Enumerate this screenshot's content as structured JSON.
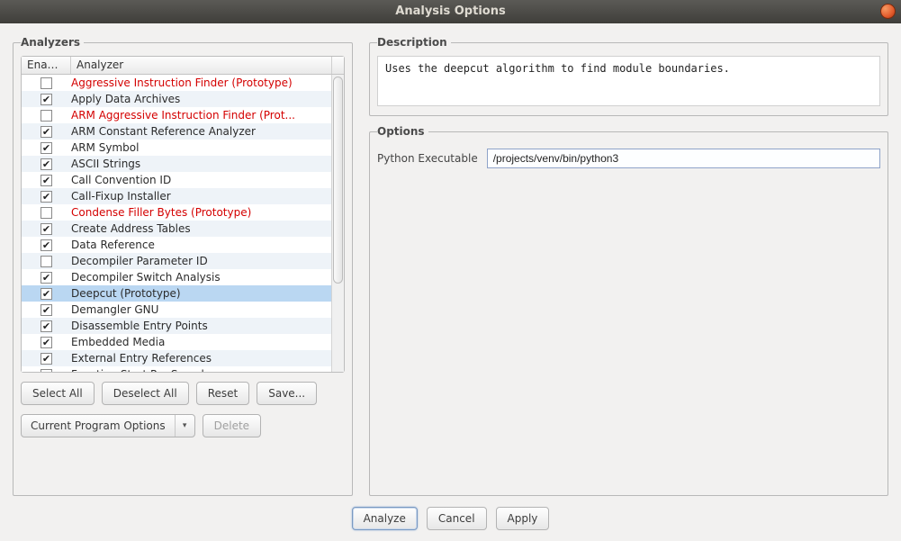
{
  "window": {
    "title": "Analysis Options"
  },
  "left": {
    "title": "Analyzers",
    "columns": {
      "enabled": "Enabl...",
      "analyzer": "Analyzer"
    },
    "rows": [
      {
        "checked": false,
        "name": "Aggressive Instruction Finder (Prototype)",
        "prototype": true
      },
      {
        "checked": true,
        "name": "Apply Data Archives"
      },
      {
        "checked": false,
        "name": "ARM Aggressive Instruction Finder (Prot...",
        "prototype": true
      },
      {
        "checked": true,
        "name": "ARM Constant Reference Analyzer"
      },
      {
        "checked": true,
        "name": "ARM Symbol"
      },
      {
        "checked": true,
        "name": "ASCII Strings"
      },
      {
        "checked": true,
        "name": "Call Convention ID"
      },
      {
        "checked": true,
        "name": "Call-Fixup Installer"
      },
      {
        "checked": false,
        "name": "Condense Filler Bytes (Prototype)",
        "prototype": true
      },
      {
        "checked": true,
        "name": "Create Address Tables"
      },
      {
        "checked": true,
        "name": "Data Reference"
      },
      {
        "checked": false,
        "name": "Decompiler Parameter ID"
      },
      {
        "checked": true,
        "name": "Decompiler Switch Analysis"
      },
      {
        "checked": true,
        "name": "Deepcut (Prototype)",
        "selected": true
      },
      {
        "checked": true,
        "name": "Demangler GNU"
      },
      {
        "checked": true,
        "name": "Disassemble Entry Points"
      },
      {
        "checked": true,
        "name": "Embedded Media"
      },
      {
        "checked": true,
        "name": "External Entry References"
      },
      {
        "checked": true,
        "name": "Function Start Pre Search"
      }
    ],
    "buttons": {
      "select_all": "Select All",
      "deselect_all": "Deselect All",
      "reset": "Reset",
      "save": "Save..."
    },
    "options_scope": "Current Program Options",
    "delete": "Delete"
  },
  "right": {
    "description_title": "Description",
    "description_text": "Uses the deepcut algorithm to find module boundaries.",
    "options_title": "Options",
    "option_python_label": "Python Executable",
    "option_python_value": "/projects/venv/bin/python3"
  },
  "footer": {
    "analyze": "Analyze",
    "cancel": "Cancel",
    "apply": "Apply"
  }
}
